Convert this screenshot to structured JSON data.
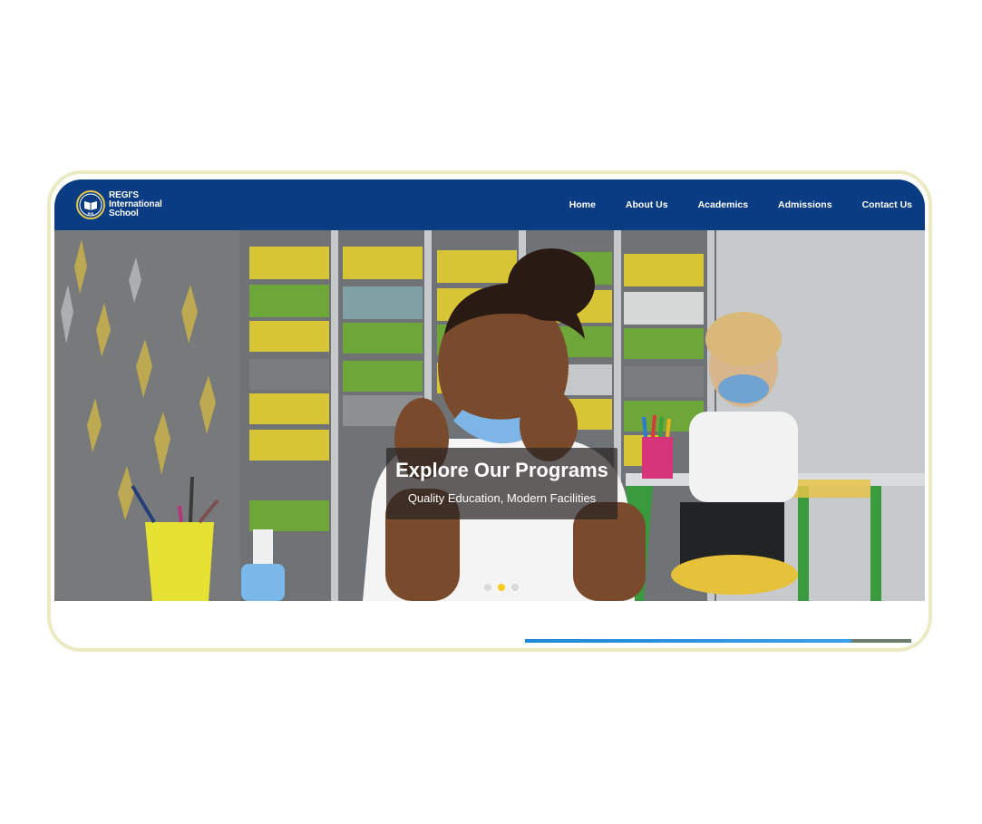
{
  "header": {
    "logo_icon": "book-emblem-icon",
    "logo_badge": "RIS",
    "brand_line1": "REGI'S",
    "brand_line2": "International",
    "brand_line3": "School",
    "background_color": "#0a3c84"
  },
  "nav": {
    "items": [
      {
        "label": "Home"
      },
      {
        "label": "About Us"
      },
      {
        "label": "Academics"
      },
      {
        "label": "Admissions"
      },
      {
        "label": "Contact Us"
      }
    ]
  },
  "hero": {
    "title": "Explore Our Programs",
    "subtitle": "Quality Education, Modern Facilities",
    "slides_total": 3,
    "active_slide": 2,
    "active_dot_color": "#f3cd1c"
  },
  "colors": {
    "frame": "#ebeac3",
    "accent_bar": "#1e88d8"
  }
}
